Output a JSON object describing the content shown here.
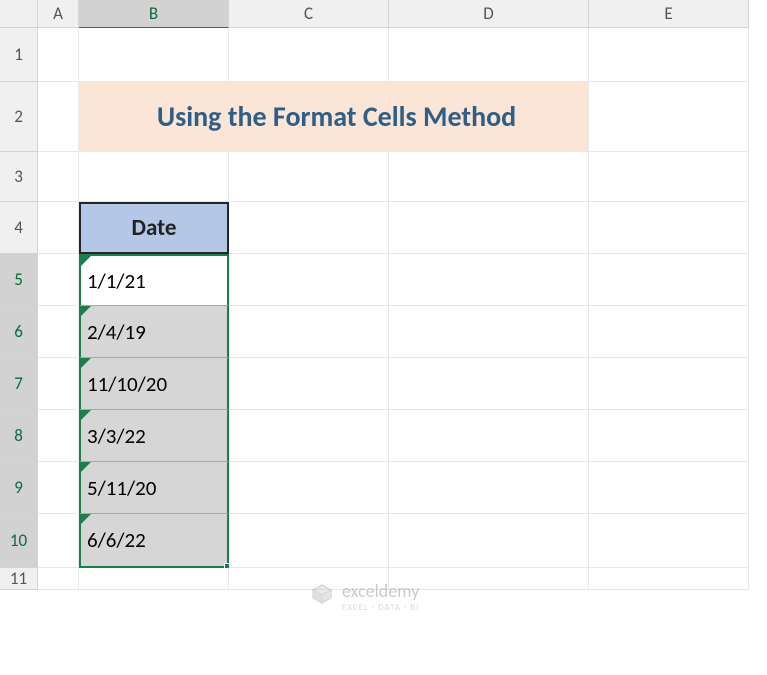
{
  "columns": [
    "A",
    "B",
    "C",
    "D",
    "E"
  ],
  "rows": [
    "1",
    "2",
    "3",
    "4",
    "5",
    "6",
    "7",
    "8",
    "9",
    "10",
    "11"
  ],
  "title": "Using the Format Cells Method",
  "header_label": "Date",
  "dates": [
    "1/1/21",
    "2/4/19",
    "11/10/20",
    "3/3/22",
    "5/11/20",
    "6/6/22"
  ],
  "watermark": {
    "brand": "exceldemy",
    "tag": "EXCEL · DATA · BI"
  },
  "chart_data": {
    "type": "table",
    "title": "Using the Format Cells Method",
    "columns": [
      "Date"
    ],
    "rows": [
      [
        "1/1/21"
      ],
      [
        "2/4/19"
      ],
      [
        "11/10/20"
      ],
      [
        "3/3/22"
      ],
      [
        "5/11/20"
      ],
      [
        "6/6/22"
      ]
    ],
    "selected_range": "B5:B10",
    "active_cell": "B5"
  }
}
